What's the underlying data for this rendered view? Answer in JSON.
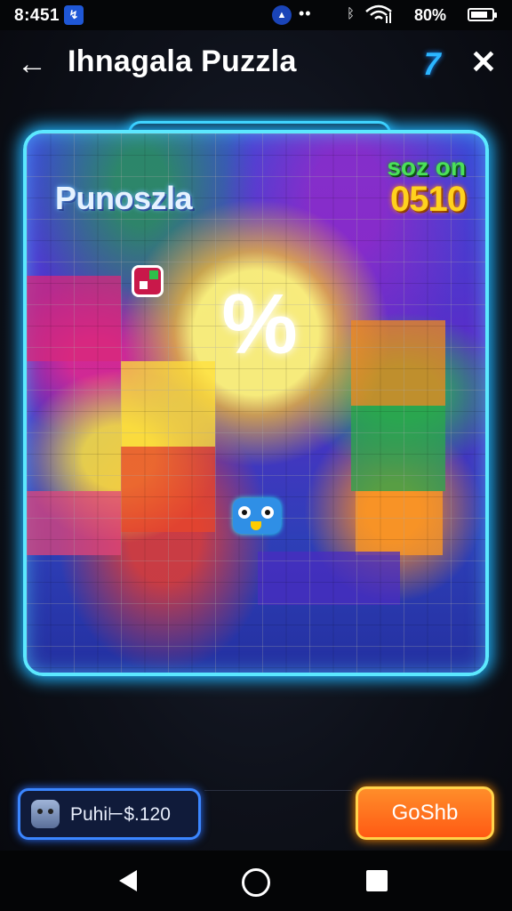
{
  "status_bar": {
    "time": "8:451",
    "app_badge": "↯",
    "dots": "••",
    "bluetooth": "ᛒ",
    "wifi": "wifi-icon",
    "battery_text": "80%",
    "battery_level": 0.8
  },
  "header": {
    "back_icon": "←",
    "title": "Ihnagala Puzzla",
    "hint_icon": "7",
    "close_icon": "✕"
  },
  "board": {
    "name_label": "Punoszla",
    "score_label": "soz on",
    "score_value": "0510",
    "center_glyph": "%",
    "colors": {
      "frame": "#5ce8ff",
      "score_label": "#4be05a",
      "score_value": "#ffd21e"
    }
  },
  "controls": {
    "pieces_label": "Puhi⊢$.120",
    "go_label": "GoShb"
  },
  "nav_bar": {
    "back": "back-nav-icon",
    "home": "home-nav-icon",
    "recents": "recents-nav-icon"
  }
}
